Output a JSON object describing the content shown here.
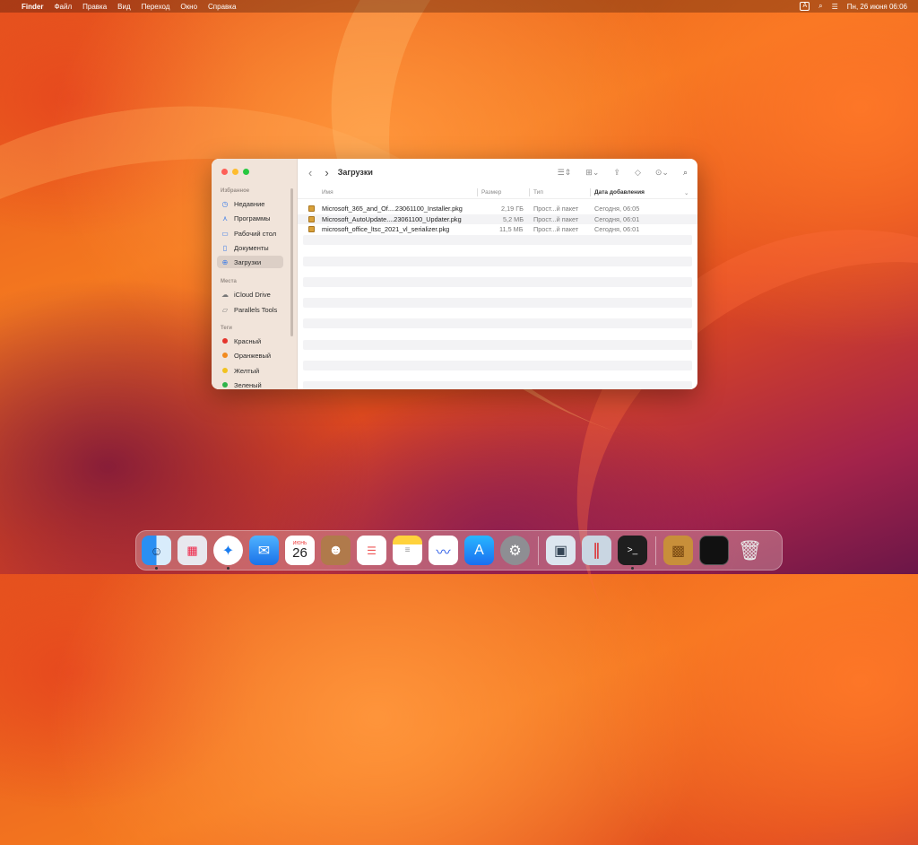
{
  "menubar": {
    "apple": "",
    "app": "Finder",
    "menus": [
      "Файл",
      "Правка",
      "Вид",
      "Переход",
      "Окно",
      "Справка"
    ],
    "input_source": "A",
    "datetime": "Пн, 26 июня  06:06"
  },
  "window": {
    "title": "Загрузки",
    "sidebar": {
      "favorites_title": "Избранное",
      "favorites": [
        "Недавние",
        "Программы",
        "Рабочий стол",
        "Документы",
        "Загрузки"
      ],
      "places_title": "Места",
      "places": [
        "iCloud Drive",
        "Parallels Tools"
      ],
      "tags_title": "Теги",
      "tags": [
        {
          "label": "Красный",
          "color": "#e5352d"
        },
        {
          "label": "Оранжевый",
          "color": "#f28a1e"
        },
        {
          "label": "Желтый",
          "color": "#f2c21e"
        },
        {
          "label": "Зеленый",
          "color": "#2fb44a"
        }
      ]
    },
    "columns": {
      "name": "Имя",
      "size": "Размер",
      "kind": "Тип",
      "date_added": "Дата добавления"
    },
    "files": [
      {
        "name": "Microsoft_365_and_Of....23061100_Installer.pkg",
        "size": "2,19 ГБ",
        "kind": "Прост...й пакет",
        "date": "Сегодня, 06:05"
      },
      {
        "name": "Microsoft_AutoUpdate....23061100_Updater.pkg",
        "size": "5,2 МБ",
        "kind": "Прост...й пакет",
        "date": "Сегодня, 06:01"
      },
      {
        "name": "microsoft_office_ltsc_2021_vl_serializer.pkg",
        "size": "11,5 МБ",
        "kind": "Прост...й пакет",
        "date": "Сегодня, 06:01"
      }
    ]
  },
  "dock": {
    "calendar_month": "ИЮНЬ",
    "calendar_day": "26",
    "apps": [
      "finder-icon",
      "launchpad-icon",
      "safari-icon",
      "mail-icon",
      "calendar-icon",
      "contacts-icon",
      "reminders-icon",
      "notes-icon",
      "freeform-icon",
      "app-store-icon",
      "system-settings-icon",
      "preview-icon",
      "parallels-icon",
      "terminal-icon",
      "installer-icon",
      "screen-icon",
      "trash-icon"
    ]
  }
}
